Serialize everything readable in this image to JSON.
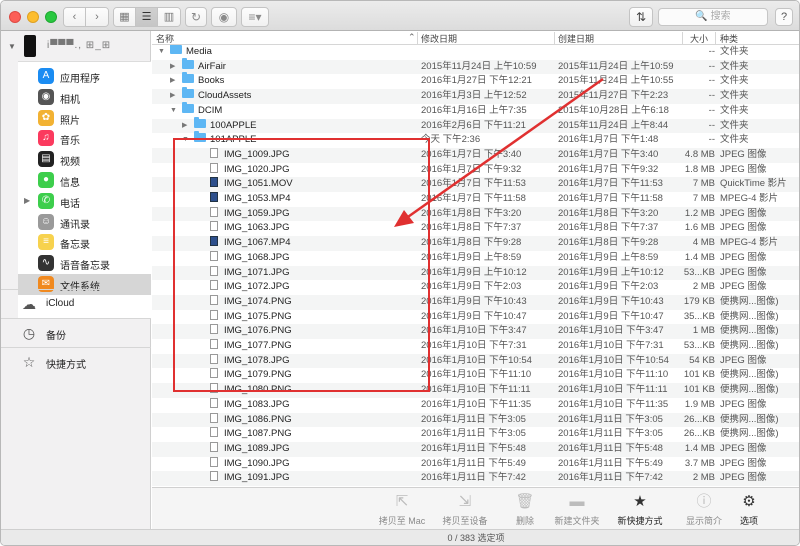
{
  "toolbar": {
    "back_icon": "‹",
    "forward_icon": "›",
    "view_icons": [
      "▦",
      "☰",
      "▥"
    ],
    "refresh_icon": "↻",
    "eye_icon": "◉",
    "arrange_icon": "≡▾",
    "sort_icon": "⇅",
    "search_placeholder": "🔍 搜索",
    "help": "?"
  },
  "sidebar": {
    "device_name": "i▀▀▀., ⊞_⊞",
    "apps": [
      {
        "label": "应用程序",
        "icon": "A",
        "color": "#1b8cf2",
        "selected": false,
        "arrow": false
      },
      {
        "label": "相机",
        "icon": "◉",
        "color": "#555555",
        "selected": false,
        "arrow": false
      },
      {
        "label": "照片",
        "icon": "✿",
        "color": "#f2b233",
        "selected": false,
        "arrow": false
      },
      {
        "label": "音乐",
        "icon": "♫",
        "color": "#fb3a5e",
        "selected": false,
        "arrow": false
      },
      {
        "label": "视频",
        "icon": "▤",
        "color": "#222222",
        "selected": false,
        "arrow": false
      },
      {
        "label": "信息",
        "icon": "●",
        "color": "#3dce4c",
        "selected": false,
        "arrow": false
      },
      {
        "label": "电话",
        "icon": "✆",
        "color": "#3dce4c",
        "selected": false,
        "arrow": true
      },
      {
        "label": "通讯录",
        "icon": "☺",
        "color": "#9a9a9a",
        "selected": false,
        "arrow": false
      },
      {
        "label": "备忘录",
        "icon": "≡",
        "color": "#f7d24e",
        "selected": false,
        "arrow": false
      },
      {
        "label": "语音备忘录",
        "icon": "∿",
        "color": "#333333",
        "selected": false,
        "arrow": false
      },
      {
        "label": "文件系统",
        "icon": "✉",
        "color": "#f0891f",
        "selected": true,
        "arrow": false
      }
    ],
    "sections": [
      {
        "label": "iCloud",
        "icon": "☁"
      },
      {
        "label": "备份",
        "icon": "◷"
      },
      {
        "label": "快捷方式",
        "icon": "☆"
      }
    ]
  },
  "columns": {
    "name": "名称",
    "modified": "修改日期",
    "created": "创建日期",
    "size": "大小",
    "kind": "种类"
  },
  "files": [
    {
      "level": 0,
      "type": "folder",
      "expanded": true,
      "name": "Media",
      "modified": "",
      "created": "",
      "size": "--",
      "kind": "文件夹"
    },
    {
      "level": 1,
      "type": "folder",
      "expanded": false,
      "name": "AirFair",
      "modified": "2015年11月24日 上午10:59",
      "created": "2015年11月24日 上午10:59",
      "size": "--",
      "kind": "文件夹"
    },
    {
      "level": 1,
      "type": "folder",
      "expanded": false,
      "name": "Books",
      "modified": "2016年1月27日 下午12:21",
      "created": "2015年11月24日 上午10:55",
      "size": "--",
      "kind": "文件夹"
    },
    {
      "level": 1,
      "type": "folder",
      "expanded": false,
      "name": "CloudAssets",
      "modified": "2016年1月3日 上午12:52",
      "created": "2015年11月27日 下午2:23",
      "size": "--",
      "kind": "文件夹"
    },
    {
      "level": 1,
      "type": "folder",
      "expanded": true,
      "name": "DCIM",
      "modified": "2016年1月16日 上午7:35",
      "created": "2015年10月28日 上午6:18",
      "size": "--",
      "kind": "文件夹"
    },
    {
      "level": 2,
      "type": "folder",
      "expanded": false,
      "name": "100APPLE",
      "modified": "2016年2月6日 下午11:21",
      "created": "2015年11月24日 上午8:44",
      "size": "--",
      "kind": "文件夹"
    },
    {
      "level": 2,
      "type": "folder",
      "expanded": true,
      "name": "101APPLE",
      "modified": "今天 下午2:36",
      "created": "2016年1月7日 下午1:48",
      "size": "--",
      "kind": "文件夹"
    },
    {
      "level": 3,
      "type": "file",
      "name": "IMG_1009.JPG",
      "modified": "2016年1月7日 下午3:40",
      "created": "2016年1月7日 下午3:40",
      "size": "4.8 MB",
      "kind": "JPEG 图像"
    },
    {
      "level": 3,
      "type": "file",
      "name": "IMG_1020.JPG",
      "modified": "2016年1月7日 下午9:32",
      "created": "2016年1月7日 下午9:32",
      "size": "1.8 MB",
      "kind": "JPEG 图像"
    },
    {
      "level": 3,
      "type": "video",
      "name": "IMG_1051.MOV",
      "modified": "2016年1月7日 下午11:53",
      "created": "2016年1月7日 下午11:53",
      "size": "7 MB",
      "kind": "QuickTime 影片"
    },
    {
      "level": 3,
      "type": "video",
      "name": "IMG_1053.MP4",
      "modified": "2016年1月7日 下午11:58",
      "created": "2016年1月7日 下午11:58",
      "size": "7 MB",
      "kind": "MPEG-4 影片"
    },
    {
      "level": 3,
      "type": "file",
      "name": "IMG_1059.JPG",
      "modified": "2016年1月8日 下午3:20",
      "created": "2016年1月8日 下午3:20",
      "size": "1.2 MB",
      "kind": "JPEG 图像"
    },
    {
      "level": 3,
      "type": "file",
      "name": "IMG_1063.JPG",
      "modified": "2016年1月8日 下午7:37",
      "created": "2016年1月8日 下午7:37",
      "size": "1.6 MB",
      "kind": "JPEG 图像"
    },
    {
      "level": 3,
      "type": "video",
      "name": "IMG_1067.MP4",
      "modified": "2016年1月8日 下午9:28",
      "created": "2016年1月8日 下午9:28",
      "size": "4 MB",
      "kind": "MPEG-4 影片"
    },
    {
      "level": 3,
      "type": "file",
      "name": "IMG_1068.JPG",
      "modified": "2016年1月9日 上午8:59",
      "created": "2016年1月9日 上午8:59",
      "size": "1.4 MB",
      "kind": "JPEG 图像"
    },
    {
      "level": 3,
      "type": "file",
      "name": "IMG_1071.JPG",
      "modified": "2016年1月9日 上午10:12",
      "created": "2016年1月9日 上午10:12",
      "size": "53...KB",
      "kind": "JPEG 图像"
    },
    {
      "level": 3,
      "type": "file",
      "name": "IMG_1072.JPG",
      "modified": "2016年1月9日 下午2:03",
      "created": "2016年1月9日 下午2:03",
      "size": "2 MB",
      "kind": "JPEG 图像"
    },
    {
      "level": 3,
      "type": "file",
      "name": "IMG_1074.PNG",
      "modified": "2016年1月9日 下午10:43",
      "created": "2016年1月9日 下午10:43",
      "size": "179 KB",
      "kind": "便携网...图像)"
    },
    {
      "level": 3,
      "type": "file",
      "name": "IMG_1075.PNG",
      "modified": "2016年1月9日 下午10:47",
      "created": "2016年1月9日 下午10:47",
      "size": "35...KB",
      "kind": "便携网...图像)"
    },
    {
      "level": 3,
      "type": "file",
      "name": "IMG_1076.PNG",
      "modified": "2016年1月10日 下午3:47",
      "created": "2016年1月10日 下午3:47",
      "size": "1 MB",
      "kind": "便携网...图像)"
    },
    {
      "level": 3,
      "type": "file",
      "name": "IMG_1077.PNG",
      "modified": "2016年1月10日 下午7:31",
      "created": "2016年1月10日 下午7:31",
      "size": "53...KB",
      "kind": "便携网...图像)"
    },
    {
      "level": 3,
      "type": "file",
      "name": "IMG_1078.JPG",
      "modified": "2016年1月10日 下午10:54",
      "created": "2016年1月10日 下午10:54",
      "size": "54 KB",
      "kind": "JPEG 图像"
    },
    {
      "level": 3,
      "type": "file",
      "name": "IMG_1079.PNG",
      "modified": "2016年1月10日 下午11:10",
      "created": "2016年1月10日 下午11:10",
      "size": "101 KB",
      "kind": "便携网...图像)"
    },
    {
      "level": 3,
      "type": "file",
      "name": "IMG_1080.PNG",
      "modified": "2016年1月10日 下午11:11",
      "created": "2016年1月10日 下午11:11",
      "size": "101 KB",
      "kind": "便携网...图像)"
    },
    {
      "level": 3,
      "type": "file",
      "name": "IMG_1083.JPG",
      "modified": "2016年1月10日 下午11:35",
      "created": "2016年1月10日 下午11:35",
      "size": "1.9 MB",
      "kind": "JPEG 图像"
    },
    {
      "level": 3,
      "type": "file",
      "name": "IMG_1086.PNG",
      "modified": "2016年1月11日 下午3:05",
      "created": "2016年1月11日 下午3:05",
      "size": "26...KB",
      "kind": "便携网...图像)"
    },
    {
      "level": 3,
      "type": "file",
      "name": "IMG_1087.PNG",
      "modified": "2016年1月11日 下午3:05",
      "created": "2016年1月11日 下午3:05",
      "size": "26...KB",
      "kind": "便携网...图像)"
    },
    {
      "level": 3,
      "type": "file",
      "name": "IMG_1089.JPG",
      "modified": "2016年1月11日 下午5:48",
      "created": "2016年1月11日 下午5:48",
      "size": "1.4 MB",
      "kind": "JPEG 图像"
    },
    {
      "level": 3,
      "type": "file",
      "name": "IMG_1090.JPG",
      "modified": "2016年1月11日 下午5:49",
      "created": "2016年1月11日 下午5:49",
      "size": "3.7 MB",
      "kind": "JPEG 图像"
    },
    {
      "level": 3,
      "type": "file",
      "name": "IMG_1091.JPG",
      "modified": "2016年1月11日 下午7:42",
      "created": "2016年1月11日 下午7:42",
      "size": "2 MB",
      "kind": "JPEG 图像"
    }
  ],
  "bottom_toolbar": [
    {
      "label": "拷贝至 Mac",
      "icon": "⇱",
      "enabled": false
    },
    {
      "label": "拷贝至设备",
      "icon": "⇲",
      "enabled": false
    },
    {
      "label": "删除",
      "icon": "🗑",
      "enabled": false
    },
    {
      "label": "新建文件夹",
      "icon": "▬",
      "enabled": false
    },
    {
      "label": "新快捷方式",
      "icon": "★",
      "enabled": true
    },
    {
      "label": "显示简介",
      "icon": "ⓘ",
      "enabled": false
    },
    {
      "label": "选项",
      "icon": "⚙",
      "enabled": true
    }
  ],
  "status_text": "0 / 383 选定项",
  "annotation_color": "#e03030"
}
